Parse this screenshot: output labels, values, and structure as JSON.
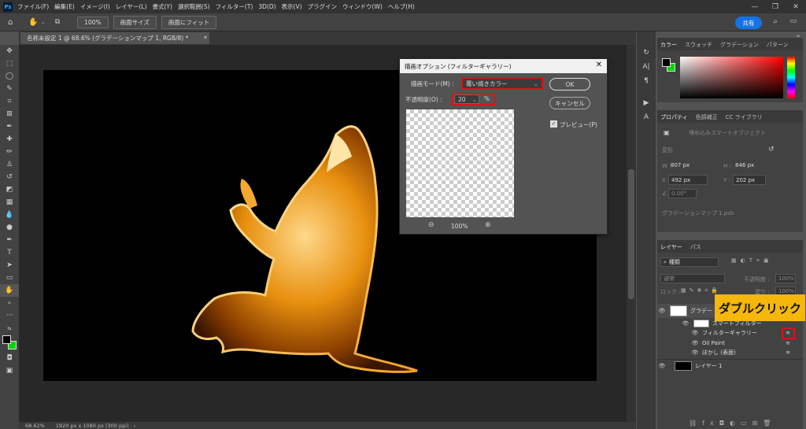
{
  "menubar": {
    "app_icon": "Ps",
    "items": [
      "ファイル(F)",
      "編集(E)",
      "イメージ(I)",
      "レイヤー(L)",
      "書式(Y)",
      "選択範囲(S)",
      "フィルター(T)",
      "3D(D)",
      "表示(V)",
      "プラグイン",
      "ウィンドウ(W)",
      "ヘルプ(H)"
    ],
    "window_controls": [
      "—",
      "❐",
      "✕"
    ]
  },
  "options": {
    "zoom": "100%",
    "fit_screen": "画面サイズ",
    "fill_screen": "画面にフィット",
    "share": "共有"
  },
  "document": {
    "tab_title": "名称未設定 1 @ 68.6% (グラデーションマップ 1, RGB/8) *",
    "zoom_status": "68.62%",
    "size_status": "1920 px x 1080 px (300 ppi)"
  },
  "dialog": {
    "title": "描画オプション (フィルターギャラリー)",
    "mode_label": "描画モード(M) :",
    "mode_value": "覆い焼きカラー",
    "opacity_label": "不透明度(O) :",
    "opacity_value": "20",
    "opacity_unit": "%",
    "ok": "OK",
    "cancel": "キャンセル",
    "preview_label": "プレビュー(P)",
    "preview_checked": true,
    "preview_zoom": "100%"
  },
  "color_panel": {
    "tabs": [
      "カラー",
      "スウォッチ",
      "グラデーション",
      "パターン"
    ],
    "foreground": "#000000",
    "background": "#00d600"
  },
  "properties_panel": {
    "tabs": [
      "プロパティ",
      "色調補正",
      "CC ライブラリ"
    ],
    "type_label": "埋め込みスマートオブジェクト",
    "transform_label": "変形",
    "w_label": "W :",
    "w_value": "807 px",
    "h_label": "H :",
    "h_value": "846 px",
    "x_label": "X :",
    "x_value": "492 px",
    "y_label": "Y :",
    "y_value": "202 px",
    "angle_value": "0.00°",
    "file_name": "グラデーションマップ 1.psb"
  },
  "layers_panel": {
    "tabs": [
      "レイヤー",
      "パス"
    ],
    "search_placeholder": "種類",
    "blend_mode": "通常",
    "opacity_label": "不透明度 :",
    "opacity_value": "100%",
    "lock_label": "ロック :",
    "fill_label": "塗り :",
    "fill_value": "100%",
    "layers": [
      {
        "name": "グラデー",
        "type": "smart"
      },
      {
        "name": "スマートフィルター",
        "type": "filter-mask"
      },
      {
        "name": "フィルターギャラリー",
        "type": "filter"
      },
      {
        "name": "Oil Paint",
        "type": "filter"
      },
      {
        "name": "ぼかし (表面)",
        "type": "filter"
      },
      {
        "name": "レイヤー 1",
        "type": "normal"
      }
    ]
  },
  "callout": "ダブルクリック"
}
